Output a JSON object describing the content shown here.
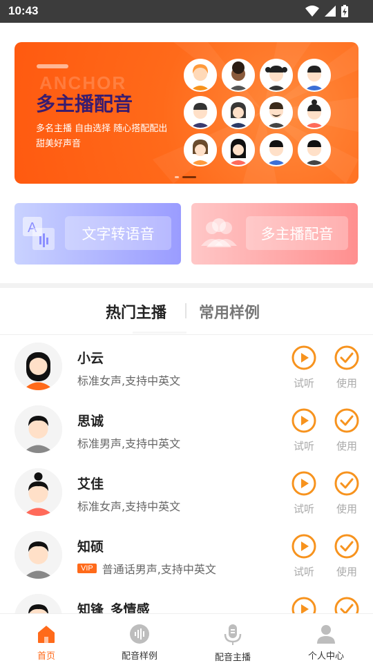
{
  "status_bar": {
    "time": "10:43"
  },
  "banner": {
    "ghost_text": "ANCHOR",
    "title": "多主播配音",
    "subtitle": "多名主播  自由选择  随心搭配配出甜美好声音",
    "active_slide": 2,
    "slides_total": 2,
    "accent": "#ff6a1a"
  },
  "features": {
    "text_to_speech": "文字转语音",
    "multi_anchor": "多主播配音"
  },
  "tabs": {
    "hot": "热门主播",
    "samples": "常用样例"
  },
  "anchors": [
    {
      "name": "小云",
      "desc": "标准女声,支持中英文",
      "vip": false
    },
    {
      "name": "思诚",
      "desc": "标准男声,支持中英文",
      "vip": false
    },
    {
      "name": "艾佳",
      "desc": "标准女声,支持中英文",
      "vip": false
    },
    {
      "name": "知硕",
      "desc": "普通话男声,支持中英文",
      "vip": true,
      "vip_label": "VIP"
    },
    {
      "name": "知锋_多情感",
      "desc": "",
      "vip": false
    }
  ],
  "actions": {
    "try": "试听",
    "use": "使用"
  },
  "bottom_nav": [
    {
      "label": "首页",
      "icon": "home-icon",
      "active": true
    },
    {
      "label": "配音样例",
      "icon": "waveform-icon",
      "active": false
    },
    {
      "label": "配音主播",
      "icon": "microphone-icon",
      "active": false
    },
    {
      "label": "个人中心",
      "icon": "user-icon",
      "active": false
    }
  ],
  "colors": {
    "accent": "#ff6a1a",
    "icon_orange": "#f7931e"
  }
}
